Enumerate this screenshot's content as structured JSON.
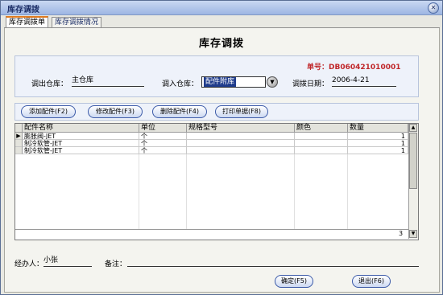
{
  "window": {
    "title": "库存调拨"
  },
  "tabs": [
    {
      "label": "库存调拨单"
    },
    {
      "label": "库存调拨情况"
    }
  ],
  "form": {
    "heading": "库存调拨",
    "doc_no_label": "单号：",
    "doc_no": "DB060421010001",
    "out_wh_label": "调出仓库：",
    "out_wh": "主仓库",
    "in_wh_label": "调入仓库：",
    "in_wh": "配件附库",
    "date_label": "调拨日期：",
    "date": "2006-4-21"
  },
  "toolbar": {
    "add": "添加配件(F2)",
    "edit": "修改配件(F3)",
    "delete": "删除配件(F4)",
    "print": "打印单据(F8)"
  },
  "table": {
    "headers": [
      "配件名称",
      "单位",
      "规格型号",
      "颜色",
      "数量"
    ],
    "rows": [
      {
        "name": "膨胀阀-JET",
        "unit": "个",
        "spec": "",
        "color": "",
        "qty": "1"
      },
      {
        "name": "制冷软管-JET",
        "unit": "个",
        "spec": "",
        "color": "",
        "qty": "1"
      },
      {
        "name": "制冷软管-JET",
        "unit": "个",
        "spec": "",
        "color": "",
        "qty": "1"
      }
    ],
    "total_rows": "3"
  },
  "footer": {
    "handler_label": "经办人：",
    "handler": "小张",
    "remark_label": "备注：",
    "remark": "",
    "ok": "确定(F5)",
    "exit": "退出(F6)"
  },
  "colors": {
    "accent_red": "#c0282b",
    "title_blue": "#1b2d66"
  }
}
